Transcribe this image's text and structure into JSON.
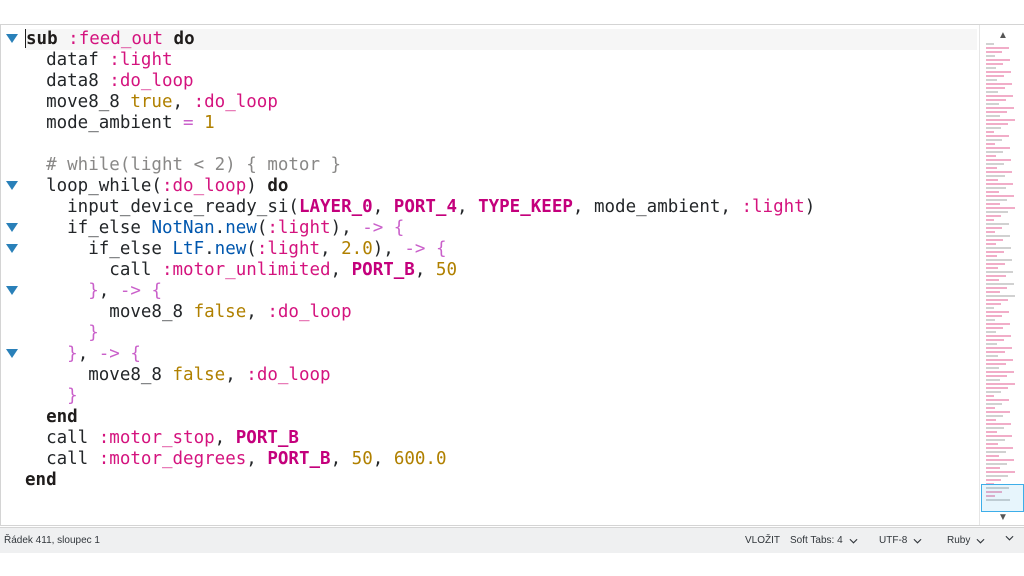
{
  "code": {
    "lines": [
      [
        [
          "kw",
          "sub"
        ],
        [
          "plain",
          " "
        ],
        [
          "sym",
          ":feed_out"
        ],
        [
          "plain",
          " "
        ],
        [
          "kw",
          "do"
        ]
      ],
      [
        [
          "plain",
          "  dataf "
        ],
        [
          "sym",
          ":light"
        ]
      ],
      [
        [
          "plain",
          "  data8 "
        ],
        [
          "sym",
          ":do_loop"
        ]
      ],
      [
        [
          "plain",
          "  move8_8 "
        ],
        [
          "bool",
          "true"
        ],
        [
          "plain",
          ", "
        ],
        [
          "sym",
          ":do_loop"
        ]
      ],
      [
        [
          "plain",
          "  mode_ambient "
        ],
        [
          "op",
          "="
        ],
        [
          "plain",
          " "
        ],
        [
          "num",
          "1"
        ]
      ],
      [
        [
          "plain",
          ""
        ]
      ],
      [
        [
          "cmt",
          "  # while(light < 2) { motor }"
        ]
      ],
      [
        [
          "plain",
          "  loop_while("
        ],
        [
          "sym",
          ":do_loop"
        ],
        [
          "plain",
          ") "
        ],
        [
          "kw",
          "do"
        ]
      ],
      [
        [
          "plain",
          "    input_device_ready_si("
        ],
        [
          "const",
          "LAYER_0"
        ],
        [
          "plain",
          ", "
        ],
        [
          "const",
          "PORT_4"
        ],
        [
          "plain",
          ", "
        ],
        [
          "const",
          "TYPE_KEEP"
        ],
        [
          "plain",
          ", mode_ambient, "
        ],
        [
          "sym",
          ":light"
        ],
        [
          "plain",
          ")"
        ]
      ],
      [
        [
          "plain",
          "    if_else "
        ],
        [
          "cls",
          "NotNan"
        ],
        [
          "plain",
          "."
        ],
        [
          "cls",
          "new"
        ],
        [
          "plain",
          "("
        ],
        [
          "sym",
          ":light"
        ],
        [
          "plain",
          "), "
        ],
        [
          "op",
          "-> {"
        ]
      ],
      [
        [
          "plain",
          "      if_else "
        ],
        [
          "cls",
          "LtF"
        ],
        [
          "plain",
          "."
        ],
        [
          "cls",
          "new"
        ],
        [
          "plain",
          "("
        ],
        [
          "sym",
          ":light"
        ],
        [
          "plain",
          ", "
        ],
        [
          "num",
          "2.0"
        ],
        [
          "plain",
          "), "
        ],
        [
          "op",
          "-> {"
        ]
      ],
      [
        [
          "plain",
          "        call "
        ],
        [
          "sym",
          ":motor_unlimited"
        ],
        [
          "plain",
          ", "
        ],
        [
          "const",
          "PORT_B"
        ],
        [
          "plain",
          ", "
        ],
        [
          "num",
          "50"
        ]
      ],
      [
        [
          "op",
          "      }"
        ],
        [
          "plain",
          ", "
        ],
        [
          "op",
          "-> {"
        ]
      ],
      [
        [
          "plain",
          "        move8_8 "
        ],
        [
          "bool",
          "false"
        ],
        [
          "plain",
          ", "
        ],
        [
          "sym",
          ":do_loop"
        ]
      ],
      [
        [
          "op",
          "      }"
        ]
      ],
      [
        [
          "op",
          "    }"
        ],
        [
          "plain",
          ", "
        ],
        [
          "op",
          "-> {"
        ]
      ],
      [
        [
          "plain",
          "      move8_8 "
        ],
        [
          "bool",
          "false"
        ],
        [
          "plain",
          ", "
        ],
        [
          "sym",
          ":do_loop"
        ]
      ],
      [
        [
          "op",
          "    }"
        ]
      ],
      [
        [
          "kw",
          "  end"
        ]
      ],
      [
        [
          "plain",
          "  call "
        ],
        [
          "sym",
          ":motor_stop"
        ],
        [
          "plain",
          ", "
        ],
        [
          "const",
          "PORT_B"
        ]
      ],
      [
        [
          "plain",
          "  call "
        ],
        [
          "sym",
          ":motor_degrees"
        ],
        [
          "plain",
          ", "
        ],
        [
          "const",
          "PORT_B"
        ],
        [
          "plain",
          ", "
        ],
        [
          "num",
          "50"
        ],
        [
          "plain",
          ", "
        ],
        [
          "num",
          "600.0"
        ]
      ],
      [
        [
          "kw",
          "end"
        ]
      ]
    ],
    "fold_markers_at_lines": [
      0,
      7,
      9,
      10,
      12,
      15
    ]
  },
  "status": {
    "cursor_position": "Řádek 411, sloupec 1",
    "input_mode": "VLOŽIT",
    "indent": "Soft Tabs: 4",
    "encoding": "UTF-8",
    "syntax": "Ruby"
  },
  "colors": {
    "keyword": "#1f1c1b",
    "symbol": "#d4137e",
    "boolean_number": "#b08000",
    "operator": "#ca60ca",
    "comment": "#898887",
    "constant": "#c4007c",
    "class": "#0057ae",
    "fold_marker": "#2980b9",
    "statusbar_bg": "#eff0f1"
  },
  "icons": {
    "fold": "fold-triangle-icon",
    "dropdown": "chevron-down-icon",
    "scroll_up": "scroll-up-arrow-icon",
    "scroll_down": "scroll-down-arrow-icon"
  }
}
